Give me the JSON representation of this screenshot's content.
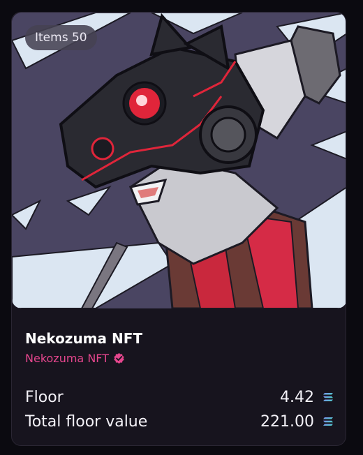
{
  "badge": {
    "items_text": "Items 50"
  },
  "collection": {
    "name": "Nekozuma NFT",
    "creator": "Nekozuma NFT",
    "creator_verified": true,
    "creator_color": "#e5468d"
  },
  "stats": [
    {
      "label": "Floor",
      "value": "4.42",
      "currency_icon": "solana-icon"
    },
    {
      "label": "Total floor value",
      "value": "221.00",
      "currency_icon": "solana-icon"
    }
  ],
  "colors": {
    "page_background": "#0b0a10",
    "card_background": "#17141e",
    "art_background": "#4b4563",
    "accent_red": "#e0253a"
  }
}
